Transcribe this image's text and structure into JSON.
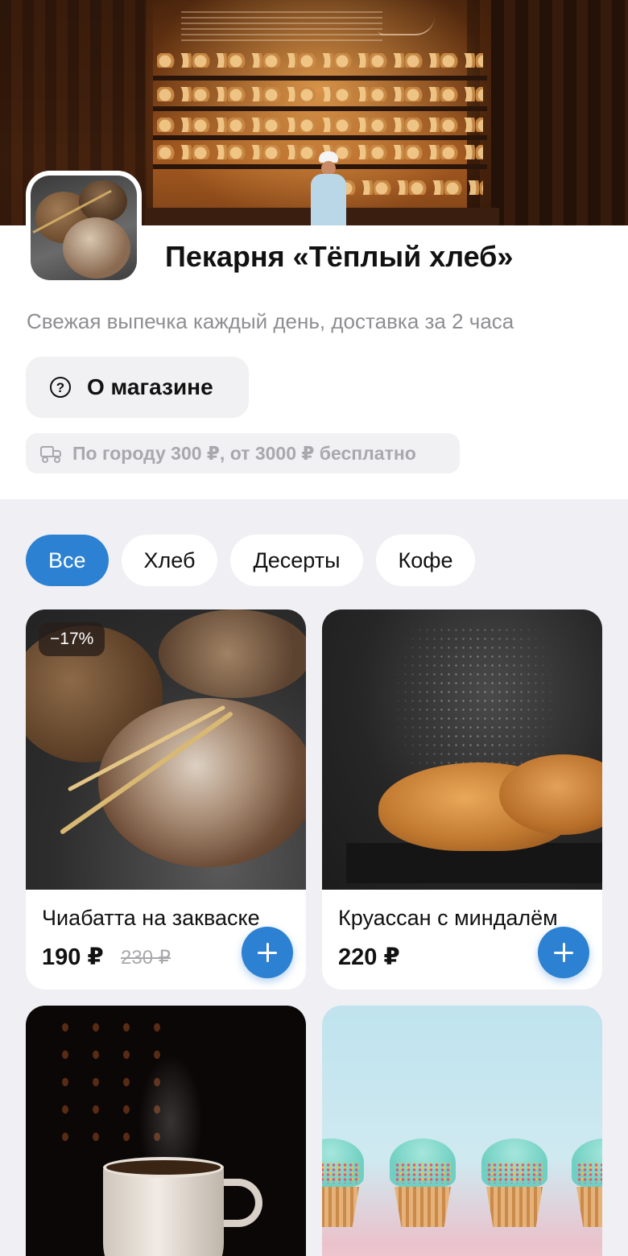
{
  "store": {
    "title": "Пекарня «Тёплый хлеб»",
    "subtitle": "Свежая выпечка каждый день, доставка за 2 часа",
    "about_label": "О магазине",
    "delivery_text": "По городу 300 ₽, от 3000 ₽ бесплатно"
  },
  "categories": [
    {
      "label": "Все",
      "active": true
    },
    {
      "label": "Хлеб",
      "active": false
    },
    {
      "label": "Десерты",
      "active": false
    },
    {
      "label": "Кофе",
      "active": false
    }
  ],
  "products": [
    {
      "name": "Чиабатта на закваске",
      "price": "190 ₽",
      "old_price": "230 ₽",
      "badge": "−17%"
    },
    {
      "name": "Круассан с миндалём",
      "price": "220 ₽"
    },
    {
      "name": "",
      "price": ""
    },
    {
      "name": "",
      "price": ""
    }
  ],
  "colors": {
    "accent": "#2d81d2",
    "background": "#efeff4",
    "muted_text": "#8e8e93",
    "chip_bg": "#ffffff"
  },
  "icons": {
    "about": "question-circle-icon",
    "delivery": "truck-icon",
    "add": "plus-icon"
  }
}
